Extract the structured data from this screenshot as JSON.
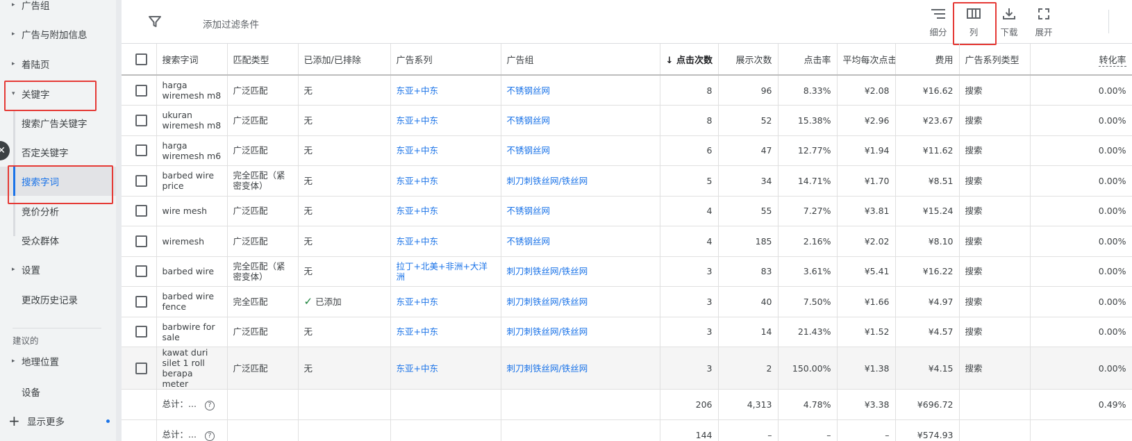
{
  "sidebar": {
    "items": [
      {
        "label": "广告组",
        "caret": "▸"
      },
      {
        "label": "广告与附加信息",
        "caret": "▸"
      },
      {
        "label": "着陆页",
        "caret": "▸"
      },
      {
        "label": "关键字",
        "caret": "▾"
      },
      {
        "label": "搜索广告关键字"
      },
      {
        "label": "否定关键字"
      },
      {
        "label": "搜索字词"
      },
      {
        "label": "竞价分析"
      },
      {
        "label": "受众群体"
      },
      {
        "label": "设置",
        "caret": "▸"
      },
      {
        "label": "更改历史记录"
      }
    ],
    "section_label": "建议的",
    "section_items": [
      {
        "label": "地理位置",
        "caret": "▸"
      },
      {
        "label": "设备"
      }
    ],
    "show_more": "显示更多"
  },
  "toolbar": {
    "filter_placeholder": "添加过滤条件",
    "tools": [
      {
        "label": "细分",
        "icon": "segment-icon"
      },
      {
        "label": "列",
        "icon": "columns-icon"
      },
      {
        "label": "下载",
        "icon": "download-icon"
      },
      {
        "label": "展开",
        "icon": "expand-icon"
      }
    ]
  },
  "table": {
    "columns": [
      "搜索字词",
      "匹配类型",
      "已添加/已排除",
      "广告系列",
      "广告组",
      "点击次数",
      "展示次数",
      "点击率",
      "平均每次点击",
      "费用",
      "广告系列类型",
      "转化率"
    ],
    "sort_arrow": "↓",
    "rows": [
      {
        "term": "harga wiremesh m8",
        "match": "广泛匹配",
        "status": "无",
        "campaign": "东亚+中东",
        "group": "不锈钢丝网",
        "clicks": "8",
        "impr": "96",
        "ctr": "8.33%",
        "cpc": "¥2.08",
        "cost": "¥16.62",
        "ctype": "搜索",
        "conv": "0.00%"
      },
      {
        "term": "ukuran wiremesh m8",
        "match": "广泛匹配",
        "status": "无",
        "campaign": "东亚+中东",
        "group": "不锈钢丝网",
        "clicks": "8",
        "impr": "52",
        "ctr": "15.38%",
        "cpc": "¥2.96",
        "cost": "¥23.67",
        "ctype": "搜索",
        "conv": "0.00%"
      },
      {
        "term": "harga wiremesh m6",
        "match": "广泛匹配",
        "status": "无",
        "campaign": "东亚+中东",
        "group": "不锈钢丝网",
        "clicks": "6",
        "impr": "47",
        "ctr": "12.77%",
        "cpc": "¥1.94",
        "cost": "¥11.62",
        "ctype": "搜索",
        "conv": "0.00%"
      },
      {
        "term": "barbed wire price",
        "match": "完全匹配（紧密变体）",
        "status": "无",
        "campaign": "东亚+中东",
        "group": "刺刀刺铁丝网/铁丝网",
        "clicks": "5",
        "impr": "34",
        "ctr": "14.71%",
        "cpc": "¥1.70",
        "cost": "¥8.51",
        "ctype": "搜索",
        "conv": "0.00%"
      },
      {
        "term": "wire mesh",
        "match": "广泛匹配",
        "status": "无",
        "campaign": "东亚+中东",
        "group": "不锈钢丝网",
        "clicks": "4",
        "impr": "55",
        "ctr": "7.27%",
        "cpc": "¥3.81",
        "cost": "¥15.24",
        "ctype": "搜索",
        "conv": "0.00%"
      },
      {
        "term": "wiremesh",
        "match": "广泛匹配",
        "status": "无",
        "campaign": "东亚+中东",
        "group": "不锈钢丝网",
        "clicks": "4",
        "impr": "185",
        "ctr": "2.16%",
        "cpc": "¥2.02",
        "cost": "¥8.10",
        "ctype": "搜索",
        "conv": "0.00%"
      },
      {
        "term": "barbed wire",
        "match": "完全匹配（紧密变体）",
        "status": "无",
        "campaign": "拉丁+北美+非洲+大洋洲",
        "group": "刺刀刺铁丝网/铁丝网",
        "clicks": "3",
        "impr": "83",
        "ctr": "3.61%",
        "cpc": "¥5.41",
        "cost": "¥16.22",
        "ctype": "搜索",
        "conv": "0.00%"
      },
      {
        "term": "barbed wire fence",
        "match": "完全匹配",
        "status": "已添加",
        "campaign": "东亚+中东",
        "group": "刺刀刺铁丝网/铁丝网",
        "clicks": "3",
        "impr": "40",
        "ctr": "7.50%",
        "cpc": "¥1.66",
        "cost": "¥4.97",
        "ctype": "搜索",
        "conv": "0.00%"
      },
      {
        "term": "barbwire for sale",
        "match": "广泛匹配",
        "status": "无",
        "campaign": "东亚+中东",
        "group": "刺刀刺铁丝网/铁丝网",
        "clicks": "3",
        "impr": "14",
        "ctr": "21.43%",
        "cpc": "¥1.52",
        "cost": "¥4.57",
        "ctype": "搜索",
        "conv": "0.00%"
      },
      {
        "term": "kawat duri silet 1 roll berapa meter",
        "match": "广泛匹配",
        "status": "无",
        "campaign": "东亚+中东",
        "group": "刺刀刺铁丝网/铁丝网",
        "clicks": "3",
        "impr": "2",
        "ctr": "150.00%",
        "cpc": "¥1.38",
        "cost": "¥4.15",
        "ctype": "搜索",
        "conv": "0.00%"
      }
    ],
    "totals": [
      {
        "label": "总计：...",
        "clicks": "206",
        "impr": "4,313",
        "ctr": "4.78%",
        "cpc": "¥3.38",
        "cost": "¥696.72",
        "conv": "0.49%"
      },
      {
        "label": "总计：...",
        "clicks": "144",
        "impr": "–",
        "ctr": "–",
        "cpc": "–",
        "cost": "¥574.93",
        "conv": ""
      }
    ]
  },
  "colors": {
    "link": "#1a73e8",
    "highlight": "#e53935",
    "added": "#188038"
  }
}
